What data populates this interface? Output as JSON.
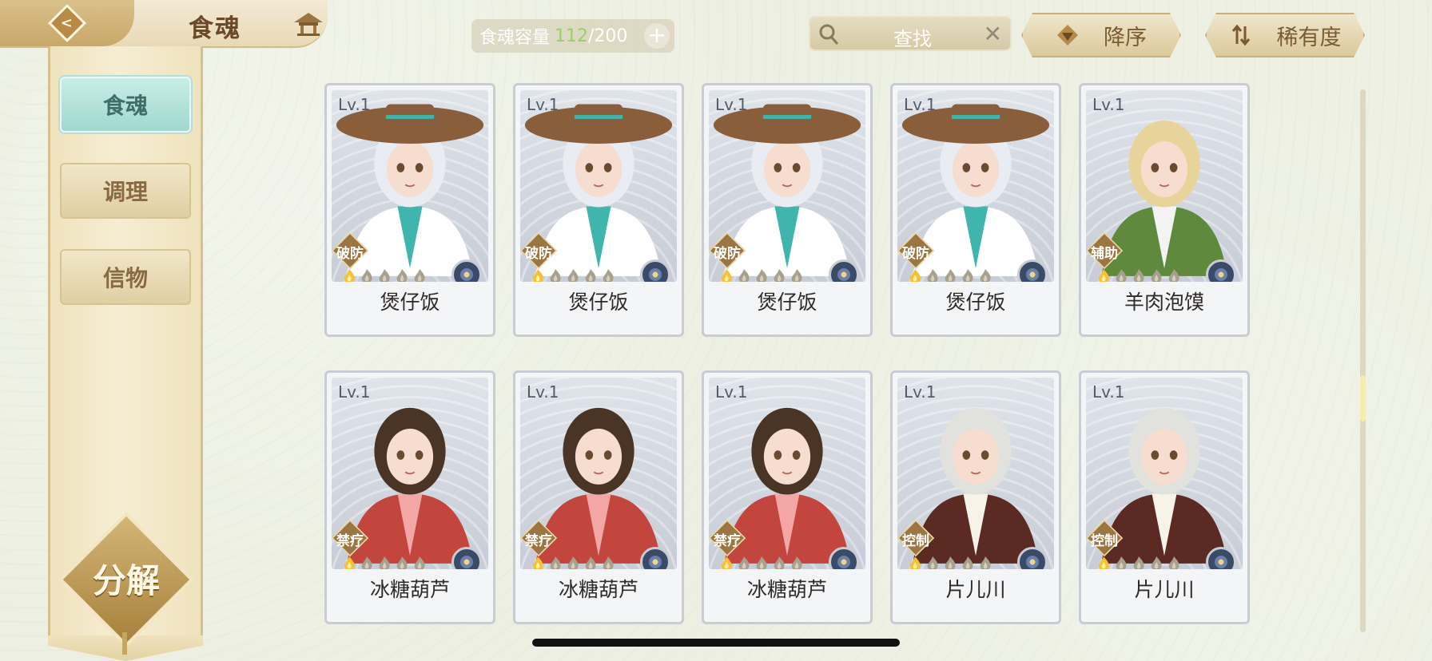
{
  "header": {
    "title": "食魂",
    "capacity_label": "食魂容量",
    "capacity_current": "112",
    "capacity_max": "/200",
    "plus_label": "+",
    "search_placeholder": "查找",
    "clear_label": "✕",
    "sort_order_label": "降序",
    "sort_rarity_label": "稀有度"
  },
  "sidebar": {
    "items": [
      {
        "label": "食魂"
      },
      {
        "label": "调理"
      },
      {
        "label": "信物"
      }
    ],
    "decompose_label": "分解"
  },
  "cards": [
    {
      "level": "Lv.1",
      "role": "破防",
      "name": "煲仔饭",
      "stars_filled": 1,
      "stars_total": 5
    },
    {
      "level": "Lv.1",
      "role": "破防",
      "name": "煲仔饭",
      "stars_filled": 1,
      "stars_total": 5
    },
    {
      "level": "Lv.1",
      "role": "破防",
      "name": "煲仔饭",
      "stars_filled": 1,
      "stars_total": 5
    },
    {
      "level": "Lv.1",
      "role": "破防",
      "name": "煲仔饭",
      "stars_filled": 1,
      "stars_total": 5
    },
    {
      "level": "Lv.1",
      "role": "辅助",
      "name": "羊肉泡馍",
      "stars_filled": 1,
      "stars_total": 5
    },
    {
      "level": "Lv.1",
      "role": "禁疗",
      "name": "冰糖葫芦",
      "stars_filled": 1,
      "stars_total": 5
    },
    {
      "level": "Lv.1",
      "role": "禁疗",
      "name": "冰糖葫芦",
      "stars_filled": 1,
      "stars_total": 5
    },
    {
      "level": "Lv.1",
      "role": "禁疗",
      "name": "冰糖葫芦",
      "stars_filled": 1,
      "stars_total": 5
    },
    {
      "level": "Lv.1",
      "role": "控制",
      "name": "片儿川",
      "stars_filled": 1,
      "stars_total": 5
    },
    {
      "level": "Lv.1",
      "role": "控制",
      "name": "片儿川",
      "stars_filled": 1,
      "stars_total": 5
    }
  ],
  "colors": {
    "capacity_current": "#9ad06a",
    "active_tab": "#9fd8cf",
    "gold": "#c9a86a"
  },
  "icons": {
    "back": "back-arrow-icon",
    "home": "pavilion-icon",
    "search": "magnifier-icon",
    "sort_desc": "triangle-down-icon",
    "sort_rarity": "swap-arrows-icon",
    "star": "flame-star-icon",
    "element": "flower-element-icon"
  }
}
